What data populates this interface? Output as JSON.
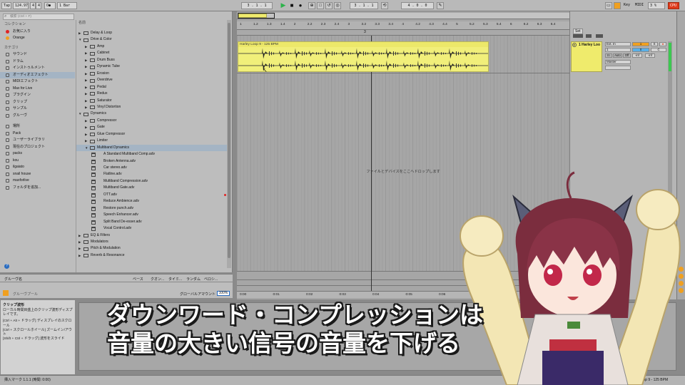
{
  "transport": {
    "tap": "Tap",
    "tempo": "124.97",
    "time_sig_num": "4",
    "time_sig_den": "4",
    "metro": "O●",
    "quantize": "1 Bar",
    "position": "3 . 1 . 1",
    "loop_start": "3 . 1 . 1",
    "loop_len": "4 . 0 . 0",
    "key_label": "Key",
    "midi_label": "MIDI",
    "cpu_value": "3 %",
    "cpu_label": "CPU"
  },
  "browser": {
    "search_placeholder": "検索 (Ctrl + F)",
    "collections_header": "コレクション",
    "collections": [
      {
        "label": "お気に入り",
        "color": "#e02424"
      },
      {
        "label": "Orange",
        "color": "#f0a020"
      }
    ],
    "categories_header": "カテゴリ",
    "categories": [
      {
        "label": "サウンド"
      },
      {
        "label": "ドラム"
      },
      {
        "label": "インストゥルメント"
      },
      {
        "label": "オーディオエフェクト",
        "selected": true
      },
      {
        "label": "MIDIエフェクト"
      },
      {
        "label": "Max for Live"
      },
      {
        "label": "プラグイン"
      },
      {
        "label": "クリップ"
      },
      {
        "label": "サンプル"
      },
      {
        "label": "グルーヴ"
      }
    ],
    "places": [
      {
        "label": "場所"
      },
      {
        "label": "Pack"
      },
      {
        "label": "ユーザーライブラリ"
      },
      {
        "label": "現在のプロジェクト"
      },
      {
        "label": "packs"
      },
      {
        "label": "kou"
      },
      {
        "label": "ilgaiato"
      },
      {
        "label": "snail house"
      },
      {
        "label": "maxforlive"
      },
      {
        "label": "フォルダを追加..."
      }
    ],
    "name_header": "名前",
    "tree": [
      {
        "label": "Delay & Loop",
        "level": 0,
        "type": "folder",
        "open": false
      },
      {
        "label": "Drive & Color",
        "level": 0,
        "type": "folder",
        "open": true
      },
      {
        "label": "Amp",
        "level": 1,
        "type": "folder"
      },
      {
        "label": "Cabinet",
        "level": 1,
        "type": "folder"
      },
      {
        "label": "Drum Buss",
        "level": 1,
        "type": "folder"
      },
      {
        "label": "Dynamic Tube",
        "level": 1,
        "type": "folder"
      },
      {
        "label": "Erosion",
        "level": 1,
        "type": "folder"
      },
      {
        "label": "Overdrive",
        "level": 1,
        "type": "folder"
      },
      {
        "label": "Pedal",
        "level": 1,
        "type": "folder"
      },
      {
        "label": "Redux",
        "level": 1,
        "type": "folder"
      },
      {
        "label": "Saturator",
        "level": 1,
        "type": "folder"
      },
      {
        "label": "Vinyl Distortion",
        "level": 1,
        "type": "folder"
      },
      {
        "label": "Dynamics",
        "level": 0,
        "type": "folder",
        "open": true
      },
      {
        "label": "Compressor",
        "level": 1,
        "type": "folder"
      },
      {
        "label": "Gate",
        "level": 1,
        "type": "folder"
      },
      {
        "label": "Glue Compressor",
        "level": 1,
        "type": "folder"
      },
      {
        "label": "Limiter",
        "level": 1,
        "type": "folder"
      },
      {
        "label": "Multiband Dynamics",
        "level": 1,
        "type": "folder",
        "open": true,
        "selected": true
      },
      {
        "label": "A Standard Multiband Comp.adv",
        "level": 2,
        "type": "file"
      },
      {
        "label": "Broken Antenna.adv",
        "level": 2,
        "type": "file"
      },
      {
        "label": "Car stereo.adv",
        "level": 2,
        "type": "file"
      },
      {
        "label": "Flatline.adv",
        "level": 2,
        "type": "file"
      },
      {
        "label": "Multiband Compression.adv",
        "level": 2,
        "type": "file"
      },
      {
        "label": "Multiband Gate.adv",
        "level": 2,
        "type": "file"
      },
      {
        "label": "OTT.adv",
        "level": 2,
        "type": "file",
        "mark": "#e02424"
      },
      {
        "label": "Reduce Ambience.adv",
        "level": 2,
        "type": "file"
      },
      {
        "label": "Restore punch.adv",
        "level": 2,
        "type": "file"
      },
      {
        "label": "Speech Enhancer.adv",
        "level": 2,
        "type": "file"
      },
      {
        "label": "Split Band De-esser.adv",
        "level": 2,
        "type": "file"
      },
      {
        "label": "Vocal Control.adv",
        "level": 2,
        "type": "file"
      },
      {
        "label": "EQ & Filters",
        "level": 0,
        "type": "folder",
        "open": false
      },
      {
        "label": "Modulators",
        "level": 0,
        "type": "folder",
        "open": false
      },
      {
        "label": "Pitch & Modulation",
        "level": 0,
        "type": "folder",
        "open": false
      },
      {
        "label": "Reverb & Resonance",
        "level": 0,
        "type": "folder",
        "open": false
      }
    ]
  },
  "groove": {
    "name_col": "グルーヴ名",
    "cols": [
      "ベース",
      "クオン...",
      "タイミ...",
      "ランダム",
      "ベロシ..."
    ],
    "pool": "グルーヴプール",
    "global_amount_label": "グローバルアマウント",
    "global_amount": "100%"
  },
  "arrangement": {
    "ruler_bars": [
      "1",
      "1.2",
      "1.3",
      "1.4",
      "2",
      "2.2",
      "2.3",
      "2.4",
      "3",
      "3.2",
      "3.3",
      "3.4",
      "4",
      "4.2",
      "4.3",
      "4.4",
      "5",
      "5.2",
      "5.3",
      "5.4",
      "6",
      "6.2",
      "6.3",
      "6.4"
    ],
    "loop_marker": "3",
    "clip_name": "Harley Loop 9 - 125 BPM",
    "drop_text": "ファイルとデバイスをここへドロップします",
    "time_ticks": [
      "0:00",
      "0:01",
      "0:02",
      "0:03",
      "0:04",
      "0:05",
      "0:06"
    ]
  },
  "mixer": {
    "set_label": "Set",
    "track_name": "1 Harley Loo",
    "input_type": "Ext. In",
    "input_ch": "1",
    "output": "Master",
    "track_num": "1",
    "solo": "S",
    "arm": "●",
    "pan": "C",
    "vol": "0",
    "monitor_in": "In",
    "monitor_auto": "Auto",
    "monitor_off": "Off",
    "send_a": "-inf",
    "send_b": "-inf"
  },
  "info": {
    "title": "クリップ波形",
    "lines": [
      "ローカル時間目盛上のクリップ波形ディスプレイです。",
      "[Ctrl + Alt + ドラッグ] ディスプレイのスクロール",
      "[Ctrl + スクロールホイール] ズームイン/アウト",
      "[Shift + Ctrl + ドラッグ] 波形をスライド"
    ]
  },
  "status": {
    "left": "挿入マーク 1.1.1 (時間: 0:00)",
    "right": "Harley Loop 9 - 125 BPM"
  },
  "caption": {
    "line1": "ダウンワード・コンプレッションは",
    "line2": "音量の大きい信号の音量を下げる"
  },
  "colors": {
    "clip": "#f1ef7a",
    "selection": "#a4b4c4",
    "play": "#2bb34a",
    "accent": "#f0a020",
    "cpu": "#e03a1a"
  }
}
